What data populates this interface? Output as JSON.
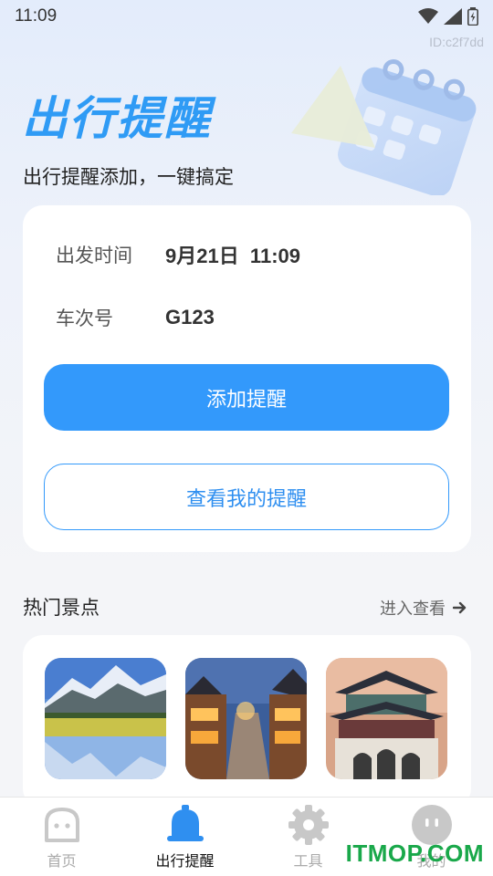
{
  "status_bar": {
    "time": "11:09",
    "app_id": "ID:c2f7dd"
  },
  "hero": {
    "title": "出行提醒",
    "subtitle": "出行提醒添加，一键搞定"
  },
  "form": {
    "departure_label": "出发时间",
    "departure_value": "9月21日  11:09",
    "train_label": "车次号",
    "train_value": "G123",
    "add_button": "添加提醒",
    "view_button": "查看我的提醒"
  },
  "spots": {
    "title": "热门景点",
    "more": "进入查看",
    "items": [
      {
        "name": "snow-mountain-lake"
      },
      {
        "name": "ancient-town-night"
      },
      {
        "name": "palace-gate"
      }
    ]
  },
  "nav": {
    "items": [
      {
        "label": "首页",
        "icon": "home-face-icon",
        "active": false
      },
      {
        "label": "出行提醒",
        "icon": "bell-icon",
        "active": true
      },
      {
        "label": "工具",
        "icon": "gear-icon",
        "active": false
      },
      {
        "label": "我的",
        "icon": "profile-face-icon",
        "active": false
      }
    ]
  },
  "watermark": "ITMOP.COM",
  "colors": {
    "accent": "#3399fb",
    "title_blue": "#2f9bf5",
    "watermark_green": "#19a84a"
  }
}
